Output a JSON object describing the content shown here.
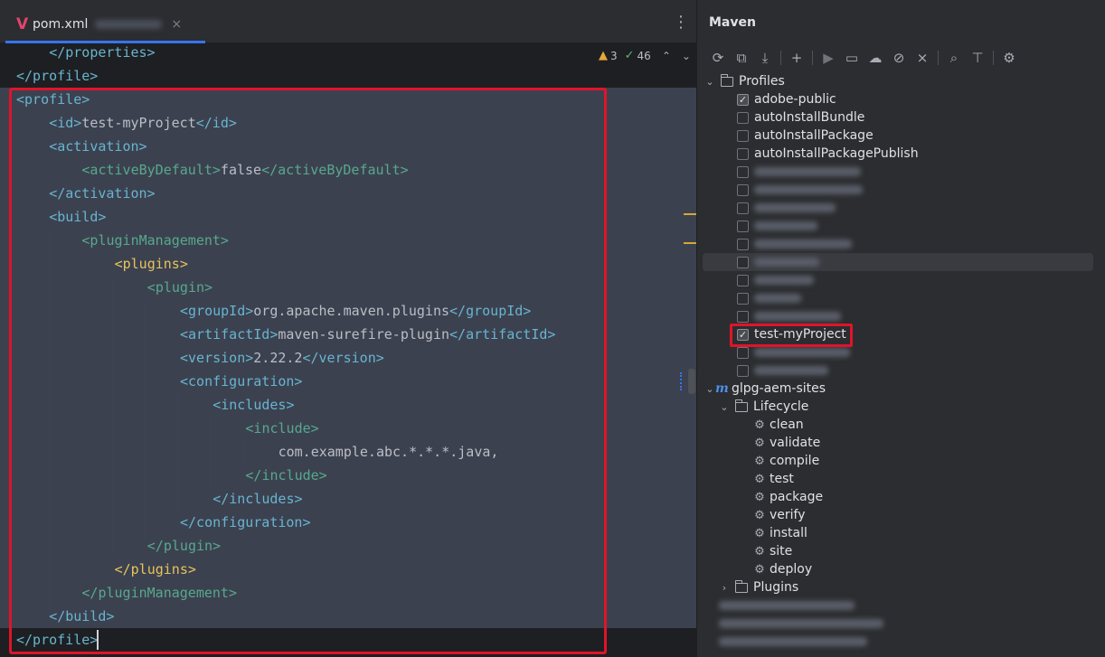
{
  "editor": {
    "tab": {
      "icon": "maven-v-icon",
      "label": "pom.xml",
      "close_label": "×"
    },
    "more_label": "⋮",
    "inspections": {
      "warnings": "3",
      "passed": "46"
    },
    "lines": [
      {
        "indent": 4,
        "parts": [
          [
            "t",
            "</properties>"
          ]
        ]
      },
      {
        "indent": 0,
        "parts": [
          [
            "t",
            "</profile>"
          ]
        ]
      },
      {
        "indent": 0,
        "parts": [
          [
            "t",
            "<profile>"
          ]
        ]
      },
      {
        "indent": 4,
        "parts": [
          [
            "t",
            "<id>"
          ],
          [
            "tx",
            "test-myProject"
          ],
          [
            "t",
            "</id>"
          ]
        ]
      },
      {
        "indent": 4,
        "parts": [
          [
            "t",
            "<activation>"
          ]
        ]
      },
      {
        "indent": 8,
        "parts": [
          [
            "tg",
            "<activeByDefault>"
          ],
          [
            "tx",
            "false"
          ],
          [
            "tg",
            "</activeByDefault>"
          ]
        ]
      },
      {
        "indent": 4,
        "parts": [
          [
            "t",
            "</activation>"
          ]
        ]
      },
      {
        "indent": 4,
        "parts": [
          [
            "t",
            "<build>"
          ]
        ]
      },
      {
        "indent": 8,
        "parts": [
          [
            "tg",
            "<pluginManagement>"
          ]
        ]
      },
      {
        "indent": 12,
        "parts": [
          [
            "ty",
            "<plugins>"
          ]
        ]
      },
      {
        "indent": 16,
        "parts": [
          [
            "tg",
            "<plugin>"
          ]
        ]
      },
      {
        "indent": 20,
        "parts": [
          [
            "t",
            "<groupId>"
          ],
          [
            "tx",
            "org.apache.maven.plugins"
          ],
          [
            "t",
            "</groupId>"
          ]
        ]
      },
      {
        "indent": 20,
        "parts": [
          [
            "t",
            "<artifactId>"
          ],
          [
            "tx",
            "maven-surefire-plugin"
          ],
          [
            "t",
            "</artifactId>"
          ]
        ]
      },
      {
        "indent": 20,
        "parts": [
          [
            "t",
            "<version>"
          ],
          [
            "tx",
            "2.22.2"
          ],
          [
            "t",
            "</version>"
          ]
        ]
      },
      {
        "indent": 20,
        "parts": [
          [
            "t",
            "<configuration>"
          ]
        ]
      },
      {
        "indent": 24,
        "parts": [
          [
            "t",
            "<includes>"
          ]
        ]
      },
      {
        "indent": 28,
        "parts": [
          [
            "tg",
            "<include>"
          ]
        ]
      },
      {
        "indent": 32,
        "parts": [
          [
            "tx",
            "com.example.abc.*.*.*.java,"
          ]
        ]
      },
      {
        "indent": 28,
        "parts": [
          [
            "tg",
            "</include>"
          ]
        ]
      },
      {
        "indent": 24,
        "parts": [
          [
            "t",
            "</includes>"
          ]
        ]
      },
      {
        "indent": 20,
        "parts": [
          [
            "t",
            "</configuration>"
          ]
        ]
      },
      {
        "indent": 16,
        "parts": [
          [
            "tg",
            "</plugin>"
          ]
        ]
      },
      {
        "indent": 12,
        "parts": [
          [
            "ty",
            "</plugins>"
          ]
        ]
      },
      {
        "indent": 8,
        "parts": [
          [
            "tg",
            "</pluginManagement>"
          ]
        ]
      },
      {
        "indent": 4,
        "parts": [
          [
            "t",
            "</build>"
          ]
        ]
      },
      {
        "indent": 0,
        "parts": [
          [
            "t",
            "</profile>"
          ]
        ]
      }
    ]
  },
  "maven": {
    "title": "Maven",
    "toolbar": [
      "reload-icon",
      "generate-sources-icon",
      "download-icon",
      "separator",
      "add-icon",
      "separator",
      "run-icon",
      "execute-goal-icon",
      "offline-icon",
      "skip-tests-icon",
      "collapse-icon",
      "separator",
      "dependencies-icon",
      "expand-all-icon",
      "separator",
      "settings-icon"
    ],
    "profiles_label": "Profiles",
    "profiles": [
      {
        "label": "adobe-public",
        "checked": true
      },
      {
        "label": "autoInstallBundle",
        "checked": false
      },
      {
        "label": "autoInstallPackage",
        "checked": false
      },
      {
        "label": "autoInstallPackagePublish",
        "checked": false
      },
      {
        "label": "",
        "checked": false,
        "blur_width": 118
      },
      {
        "label": "",
        "checked": false,
        "blur_width": 120
      },
      {
        "label": "",
        "checked": false,
        "blur_width": 90
      },
      {
        "label": "",
        "checked": false,
        "blur_width": 70
      },
      {
        "label": "",
        "checked": false,
        "blur_width": 108
      },
      {
        "label": "",
        "checked": false,
        "blur_width": 72
      },
      {
        "label": "",
        "checked": false,
        "blur_width": 66
      },
      {
        "label": "",
        "checked": false,
        "blur_width": 52
      },
      {
        "label": "",
        "checked": false,
        "blur_width": 96
      },
      {
        "label": "test-myProject",
        "checked": true
      },
      {
        "label": "",
        "checked": false,
        "blur_width": 106
      },
      {
        "label": "",
        "checked": false,
        "blur_width": 82
      }
    ],
    "project_label": "glpg-aem-sites",
    "lifecycle_label": "Lifecycle",
    "lifecycle": [
      "clean",
      "validate",
      "compile",
      "test",
      "package",
      "verify",
      "install",
      "site",
      "deploy"
    ],
    "plugins_label": "Plugins",
    "modules_blurred": [
      {
        "blur_width": 150
      },
      {
        "blur_width": 182
      },
      {
        "blur_width": 164
      }
    ]
  }
}
